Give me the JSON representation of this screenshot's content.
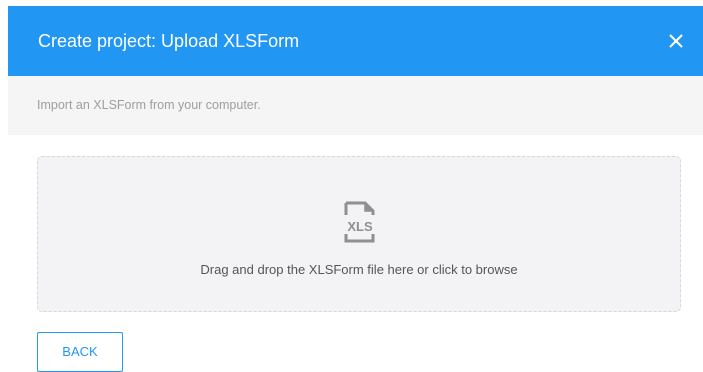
{
  "header": {
    "title": "Create project: Upload XLSForm",
    "background_color": "#2196f3",
    "close_icon": "close-icon"
  },
  "subheader": {
    "text": "Import an XLSForm from your computer."
  },
  "dropzone": {
    "icon": "xls-file-icon",
    "icon_text": "XLS",
    "text": "Drag and drop the XLSForm file here or click to browse"
  },
  "footer": {
    "back_label": "BACK",
    "accent_color": "#2196f3"
  }
}
